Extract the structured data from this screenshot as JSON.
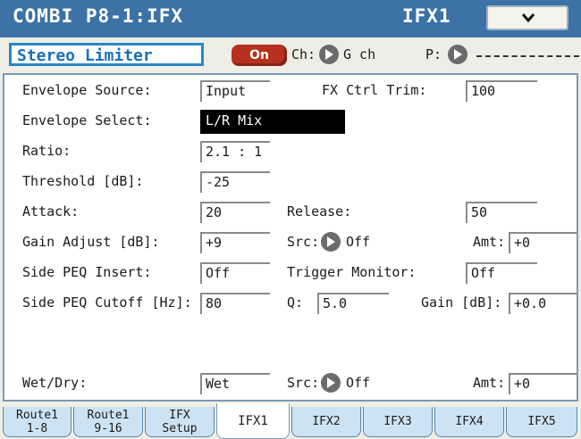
{
  "header": {
    "title": "COMBI P8-1:IFX",
    "page": "IFX1"
  },
  "effect": {
    "name": "Stereo Limiter",
    "on_label": "On",
    "ch_label": "Ch:",
    "ch_value": "G ch",
    "p_label": "P:"
  },
  "params": {
    "envelope_source": {
      "label": "Envelope Source:",
      "value": "Input"
    },
    "fx_ctrl_trim": {
      "label": "FX Ctrl Trim:",
      "value": "100"
    },
    "envelope_select": {
      "label": "Envelope Select:",
      "value": "L/R Mix"
    },
    "ratio": {
      "label": "Ratio:",
      "value": "2.1 : 1"
    },
    "threshold": {
      "label": "Threshold [dB]:",
      "value": "-25"
    },
    "attack": {
      "label": "Attack:",
      "value": "20"
    },
    "release": {
      "label": "Release:",
      "value": "50"
    },
    "gain_adjust": {
      "label": "Gain Adjust [dB]:",
      "value": "+9"
    },
    "gain_src": {
      "label": "Src:",
      "value": "Off"
    },
    "gain_amt": {
      "label": "Amt:",
      "value": "+0"
    },
    "side_peq_insert": {
      "label": "Side PEQ Insert:",
      "value": "Off"
    },
    "trigger_monitor": {
      "label": "Trigger Monitor:",
      "value": "Off"
    },
    "side_peq_cutoff": {
      "label": "Side PEQ Cutoff [Hz]:",
      "value": "80"
    },
    "q": {
      "label": "Q:",
      "value": "5.0"
    },
    "side_gain": {
      "label": "Gain [dB]:",
      "value": "+0.0"
    },
    "wet_dry": {
      "label": "Wet/Dry:",
      "value": "Wet"
    },
    "wet_src": {
      "label": "Src:",
      "value": "Off"
    },
    "wet_amt": {
      "label": "Amt:",
      "value": "+0"
    }
  },
  "tabs": [
    {
      "line1": "Route1",
      "line2": "1-8"
    },
    {
      "line1": "Route1",
      "line2": "9-16"
    },
    {
      "line1": "IFX",
      "line2": "Setup"
    },
    {
      "line1": "IFX1",
      "line2": ""
    },
    {
      "line1": "IFX2",
      "line2": ""
    },
    {
      "line1": "IFX3",
      "line2": ""
    },
    {
      "line1": "IFX4",
      "line2": ""
    },
    {
      "line1": "IFX5",
      "line2": ""
    }
  ],
  "colors": {
    "title_bar": "#3c72a6",
    "on_button": "#b5311e",
    "fx_name": "#1a6fb8",
    "tab_bg": "#cde3f3"
  }
}
